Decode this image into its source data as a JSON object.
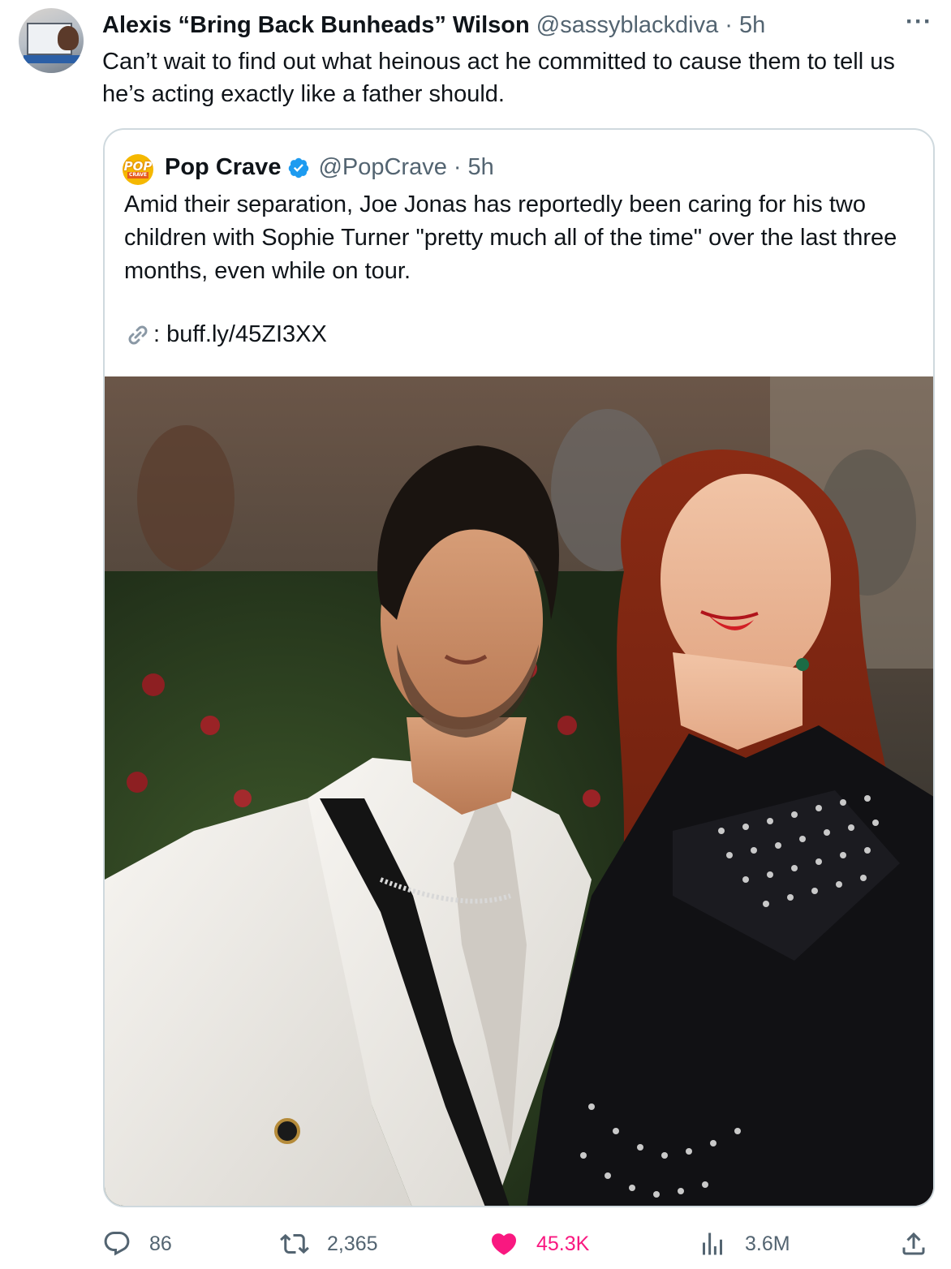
{
  "tweet": {
    "author_name": "Alexis “Bring Back Bunheads” Wilson",
    "author_handle": "@sassyblackdiva",
    "separator": "·",
    "time": "5h",
    "more_label": "···",
    "text": "Can’t wait to find out what heinous act he committed to cause them to tell us he’s acting exactly like a father should."
  },
  "quoted": {
    "logo_text_top": "POP",
    "logo_text_bottom": "CRAVE",
    "author_name": "Pop Crave",
    "author_handle": "@PopCrave",
    "separator": "·",
    "time": "5h",
    "text": "Amid their separation, Joe Jonas has reportedly been caring for his two children with Sophie Turner \"pretty much all of the time\" over the last three months, even while on tour.",
    "link_prefix": ":",
    "link_text": "buff.ly/45ZI3XX"
  },
  "actions": {
    "replies": "86",
    "retweets": "2,365",
    "likes": "45.3K",
    "views": "3.6M"
  },
  "colors": {
    "primary_text": "#0f1419",
    "secondary_text": "#536471",
    "like_pink": "#f91880",
    "verified_blue": "#1d9bf0",
    "border": "#cfd9de"
  },
  "icons": {
    "reply": "reply-icon",
    "retweet": "retweet-icon",
    "like": "heart-icon",
    "views": "views-icon",
    "share": "share-icon",
    "link": "link-icon",
    "verified": "verified-badge-icon"
  }
}
